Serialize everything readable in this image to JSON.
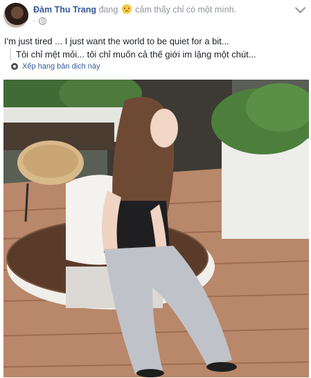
{
  "post": {
    "author_name": "Đàm Thu Trang",
    "feeling_prefix": "đang",
    "feeling_text": "cảm thấy chỉ có một mình.",
    "body_text": "I'm just tired ... I just want the world to be quiet for a bit...",
    "translation_text": "Tôi chỉ mệt mỏi... tôi chỉ muốn cả thế giới im lặng một chút...",
    "rate_translation_label": "Xếp hạng bản dịch này",
    "privacy_icon": "globe-icon",
    "menu_icon": "chevron-down-icon"
  },
  "colors": {
    "author_link": "#365899",
    "meta_gray": "#90949c",
    "text": "#1d2129"
  }
}
